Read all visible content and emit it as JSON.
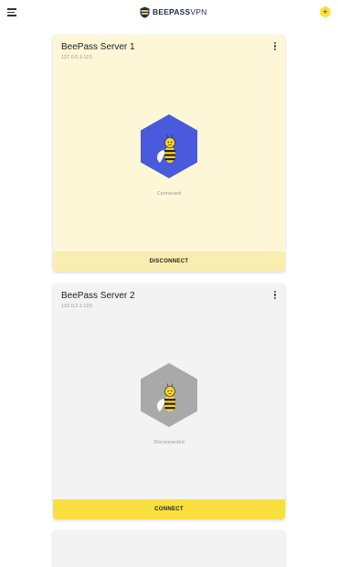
{
  "app": {
    "logo_bold": "BEEPASS",
    "logo_thin": "VPN",
    "add_label": "+"
  },
  "servers": [
    {
      "name": "BeePass Server 1",
      "ip": "127.0.0.1:123",
      "status": "Connected",
      "action": "DISCONNECT",
      "hex_color": "#4a5adc"
    },
    {
      "name": "BeePass Server 2",
      "ip": "192.0.2.1:123",
      "status": "Disconnected",
      "action": "CONNECT",
      "hex_color": "#a9a9a9"
    }
  ],
  "colors": {
    "accent_yellow": "#f9e03f",
    "connected_bg": "#fdf7d7",
    "disconnected_bg": "#f3f3f3"
  },
  "icons": [
    "menu-icon",
    "beepass-logo-icon",
    "add-server-icon",
    "more-vert-icon",
    "bee-icon"
  ]
}
